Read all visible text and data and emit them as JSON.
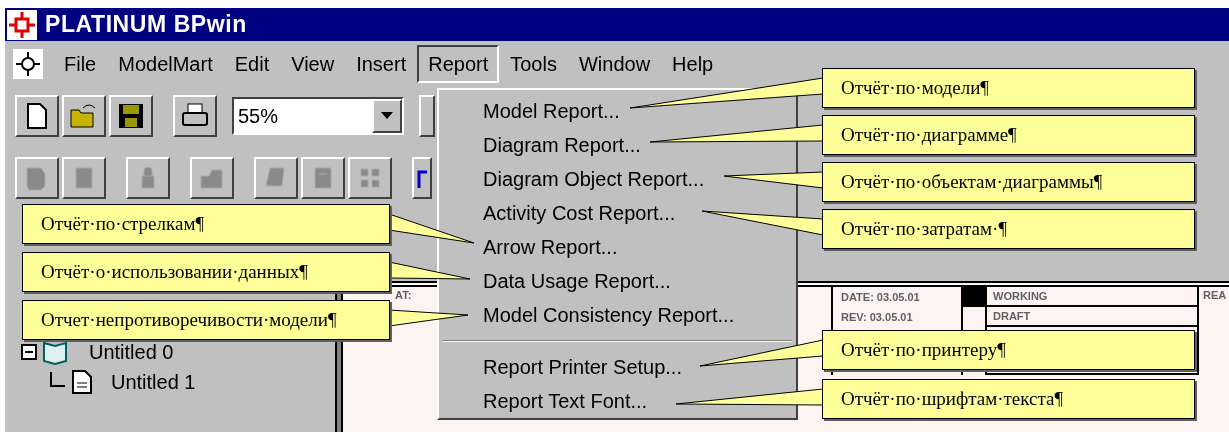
{
  "window": {
    "title": "PLATINUM BPwin"
  },
  "menu_bar": [
    {
      "label": "File",
      "selected": false
    },
    {
      "label": "ModelMart",
      "selected": false
    },
    {
      "label": "Edit",
      "selected": false
    },
    {
      "label": "View",
      "selected": false
    },
    {
      "label": "Insert",
      "selected": false
    },
    {
      "label": "Report",
      "selected": true
    },
    {
      "label": "Tools",
      "selected": false
    },
    {
      "label": "Window",
      "selected": false
    },
    {
      "label": "Help",
      "selected": false
    }
  ],
  "toolbar": {
    "zoom": "55%"
  },
  "tree": [
    {
      "label": "Untitled 0",
      "expanded": true,
      "children": [
        {
          "label": "Untitled 1"
        }
      ]
    }
  ],
  "diagram_frame": {
    "used_at": "AT:",
    "date": "DATE: 03.05.01",
    "rev": "REV: 03.05.01",
    "working": "WORKING",
    "draft": "DRAFT",
    "column_5": "REA"
  },
  "report_menu": [
    {
      "kind": "item",
      "label": "Model Report..."
    },
    {
      "kind": "item",
      "label": "Diagram Report..."
    },
    {
      "kind": "item",
      "label": "Diagram Object Report..."
    },
    {
      "kind": "item",
      "label": "Activity Cost Report..."
    },
    {
      "kind": "item",
      "label": "Arrow Report..."
    },
    {
      "kind": "item",
      "label": "Data Usage Report..."
    },
    {
      "kind": "item",
      "label": "Model Consistency Report..."
    },
    {
      "kind": "separator"
    },
    {
      "kind": "item",
      "label": "Report Printer Setup..."
    },
    {
      "kind": "item",
      "label": "Report Text Font..."
    }
  ],
  "callouts": [
    {
      "text": "Отчёт·по·модели¶"
    },
    {
      "text": "Отчёт·по·диаграмме¶"
    },
    {
      "text": "Отчёт·по·объектам·диаграммы¶"
    },
    {
      "text": "Отчёт·по·стрелкам¶"
    },
    {
      "text": "Отчёт·по·затратам·¶"
    },
    {
      "text": "Отчёт·о·использовании·данных¶"
    },
    {
      "text": "Отчет·непротиворечивости·модели¶"
    },
    {
      "text": "Отчёт·по·принтеру¶"
    },
    {
      "text": "Отчёт·по·шрифтам·текста¶"
    }
  ]
}
